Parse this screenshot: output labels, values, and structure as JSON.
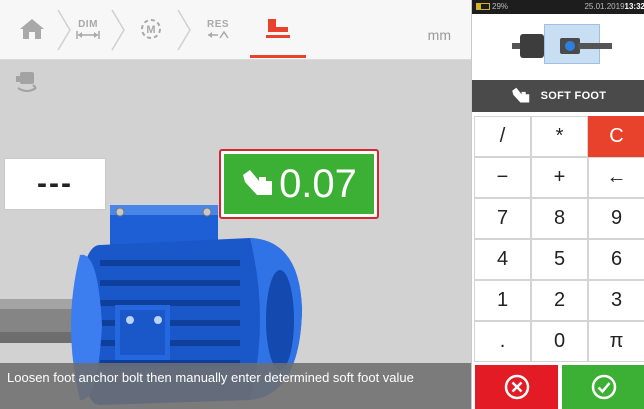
{
  "toolbar": {
    "items": [
      {
        "name": "home",
        "label": ""
      },
      {
        "name": "dimensions",
        "label": "DIM"
      },
      {
        "name": "measure",
        "label": ""
      },
      {
        "name": "results",
        "label": "RES"
      },
      {
        "name": "soft-foot",
        "label": ""
      }
    ],
    "unit": "mm"
  },
  "measurement": {
    "placeholder_value": "---",
    "soft_foot_value": "0.07"
  },
  "status_message": "Loosen foot anchor bolt then manually enter determined soft foot value",
  "device_status": {
    "battery": "29%",
    "date": "25.01.2019",
    "time": "13:32"
  },
  "panel": {
    "title": "SOFT FOOT"
  },
  "keypad": {
    "keys": [
      "/",
      "*",
      "C",
      "−",
      "+",
      "←",
      "7",
      "8",
      "9",
      "4",
      "5",
      "6",
      "1",
      "2",
      "3",
      ".",
      "0",
      "π"
    ]
  },
  "colors": {
    "accent_red": "#e8412c",
    "value_green": "#3cb035",
    "cancel_red": "#e21b25",
    "motor_blue": "#1e5fd6"
  }
}
